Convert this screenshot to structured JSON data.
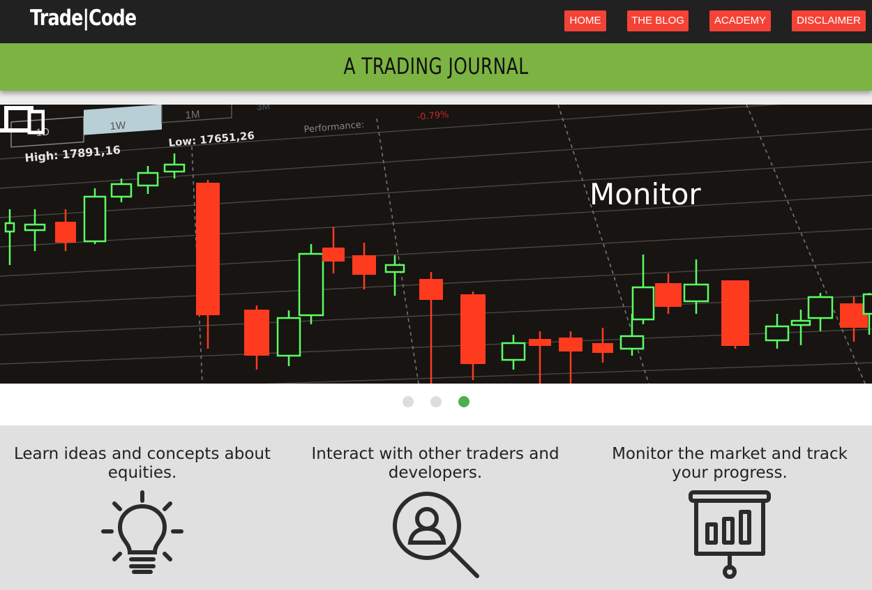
{
  "navbar": {
    "brand": "Trade|Code",
    "links": [
      "HOME",
      "THE BLOG",
      "ACADEMY",
      "DISCLAIMER"
    ],
    "link_color": "#f44336"
  },
  "banner": {
    "title": "A TRADING JOURNAL",
    "color": "#7cb342"
  },
  "slider": {
    "chart_labels": {
      "tabs": [
        "1D",
        "1W",
        "1M",
        "3M"
      ],
      "high": "High: 17891,16",
      "low": "Low: 17651,26",
      "performance": "Performance:",
      "performance_value": "-0.79%"
    },
    "caption": "Monitor",
    "caption_icon": "devices-icon",
    "dots": 3,
    "active_dot": 3,
    "active_dot_color": "#4caf50"
  },
  "features": [
    {
      "text": "Learn ideas and concepts about equities.",
      "icon": "lightbulb-icon"
    },
    {
      "text": "Interact with other traders and developers.",
      "icon": "user-search-icon"
    },
    {
      "text": "Monitor the market and track your progress.",
      "icon": "presentation-chart-icon"
    }
  ]
}
